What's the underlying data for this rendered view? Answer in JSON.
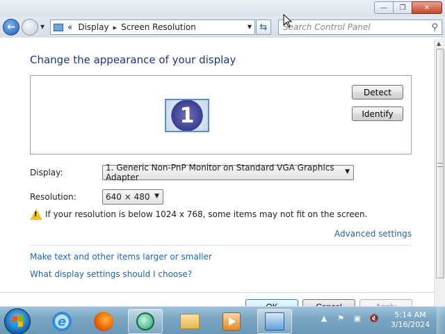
{
  "window": {
    "minimize_glyph": "—",
    "maximize_glyph": "❐",
    "close_glyph": "✕"
  },
  "address_bar": {
    "back_glyph": "←",
    "overflow": "«",
    "crumbs": [
      "Display",
      "Screen Resolution"
    ],
    "separator": "▸",
    "search_placeholder": "Search Control Panel",
    "refresh_glyph": "⇆"
  },
  "main": {
    "heading": "Change the appearance of your display",
    "monitor_number": "1",
    "detect_label": "Detect",
    "identify_label": "Identify",
    "display_label": "Display:",
    "display_value": "1. Generic Non-PnP Monitor on Standard VGA Graphics Adapter",
    "resolution_label": "Resolution:",
    "resolution_value": "640 × 480",
    "warning_text": "If your resolution is below 1024 x 768, some items may not fit on the screen.",
    "advanced_link": "Advanced settings",
    "link_text_size": "Make text and other items larger or smaller",
    "link_choose": "What display settings should I choose?",
    "ok_label": "OK",
    "cancel_label": "Cancel",
    "apply_label": "Apply"
  },
  "taskbar": {
    "apps": [
      "start-button",
      "internet-explorer-icon",
      "firefox-icon",
      "app-globe-icon",
      "windows-explorer-icon",
      "media-player-icon",
      "control-panel-icon"
    ],
    "tray_glyphs": [
      "▲",
      "⚑",
      "▣",
      "🔇"
    ],
    "time": "5:14 AM",
    "date": "3/16/2024"
  },
  "colors": {
    "heading": "#1e3287",
    "link": "#1e64a8",
    "taskbar": "#7ba7c4",
    "warning": "#f3c21b"
  }
}
